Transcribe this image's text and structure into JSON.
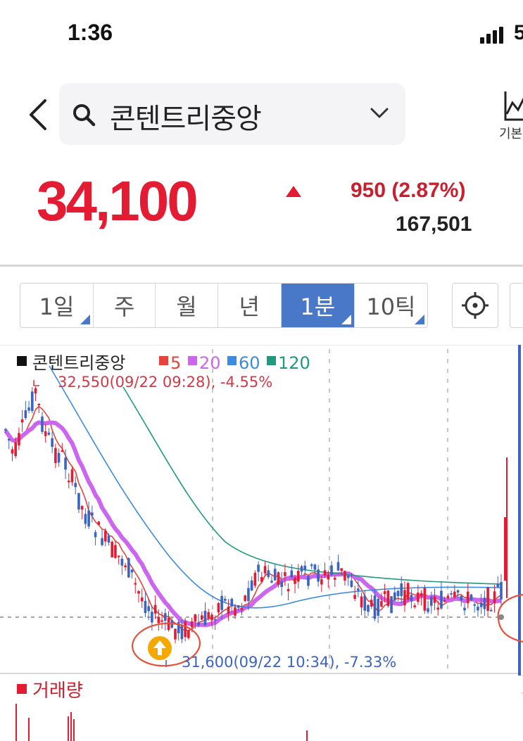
{
  "status_bar": {
    "time": "1:36",
    "battery_partial": "5"
  },
  "header": {
    "search_value": "콘텐트리중앙",
    "basic_chart_label": "기본"
  },
  "price": {
    "current": "34,100",
    "change": "950 (2.87%)",
    "volume": "167,501"
  },
  "tabs": [
    {
      "label": "1일",
      "corner": true,
      "active": false
    },
    {
      "label": "주",
      "corner": false,
      "active": false
    },
    {
      "label": "월",
      "corner": false,
      "active": false
    },
    {
      "label": "년",
      "corner": false,
      "active": false
    },
    {
      "label": "1분",
      "corner": true,
      "active": true
    },
    {
      "label": "10틱",
      "corner": true,
      "active": false
    }
  ],
  "colors": {
    "up_red": "#e31b33",
    "down_blue": "#3a64c4",
    "ma5": "#e4443c",
    "ma20": "#cc66ee",
    "ma60": "#3c8be0",
    "ma120": "#1f9a7e",
    "active_tab": "#4a78c9"
  },
  "chart_data": {
    "type": "candlestick",
    "legend": {
      "name": "콘텐트리중앙",
      "ma": [
        {
          "label": "5",
          "color": "#e4443c"
        },
        {
          "label": "20",
          "color": "#cc66ee"
        },
        {
          "label": "60",
          "color": "#3c8be0"
        },
        {
          "label": "120",
          "color": "#1f9a7e"
        }
      ]
    },
    "high_annotation": "32,550(09/22 09:28), -4.55%",
    "low_annotation": "31,600(09/22 10:34), -7.33%",
    "high_value": 32550,
    "low_value": 31600,
    "volume_label": "거래량"
  }
}
